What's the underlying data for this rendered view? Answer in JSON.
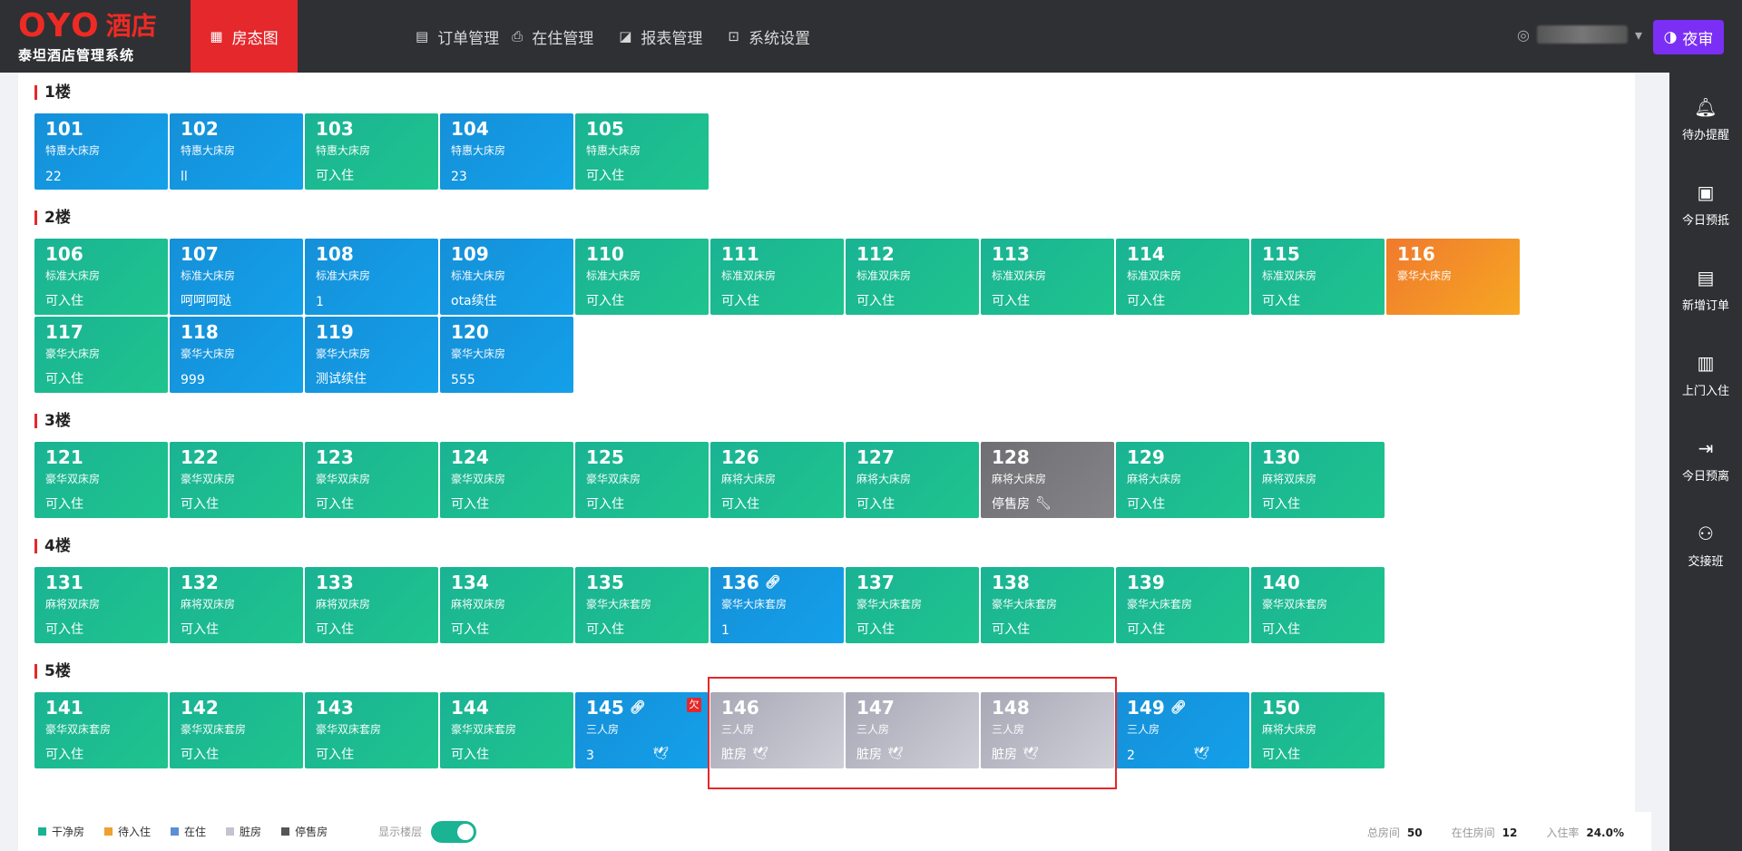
{
  "brand": {
    "logo_text": "OYO",
    "logo_hotel": "酒店",
    "system_name": "泰坦酒店管理系统"
  },
  "nav": [
    {
      "label": "房态图",
      "icon": "grid-icon",
      "active": true
    },
    {
      "label": "订单管理",
      "icon": "document-icon",
      "active": false
    },
    {
      "label": "在住管理",
      "icon": "printer-icon",
      "active": false
    },
    {
      "label": "报表管理",
      "icon": "chart-icon",
      "active": false
    },
    {
      "label": "系统设置",
      "icon": "monitor-icon",
      "active": false
    }
  ],
  "user": {
    "caret": "▾"
  },
  "night_audit": {
    "label": "夜审"
  },
  "sidebar": [
    {
      "label": "待办提醒",
      "icon": "bell-icon"
    },
    {
      "label": "今日预抵",
      "icon": "calendar-check-icon"
    },
    {
      "label": "新增订单",
      "icon": "new-order-icon"
    },
    {
      "label": "上门入住",
      "icon": "walk-in-icon"
    },
    {
      "label": "今日预离",
      "icon": "checkout-icon"
    },
    {
      "label": "交接班",
      "icon": "handover-icon"
    }
  ],
  "floors": [
    {
      "label": "1楼",
      "rooms": [
        {
          "num": "101",
          "type": "特惠大床房",
          "status": "22",
          "color": "blue"
        },
        {
          "num": "102",
          "type": "特惠大床房",
          "status": "ll",
          "color": "blue"
        },
        {
          "num": "103",
          "type": "特惠大床房",
          "status": "可入住",
          "color": "green"
        },
        {
          "num": "104",
          "type": "特惠大床房",
          "status": "23",
          "color": "blue"
        },
        {
          "num": "105",
          "type": "特惠大床房",
          "status": "可入住",
          "color": "green"
        }
      ]
    },
    {
      "label": "2楼",
      "rooms": [
        {
          "num": "106",
          "type": "标准大床房",
          "status": "可入住",
          "color": "green"
        },
        {
          "num": "107",
          "type": "标准大床房",
          "status": "呵呵呵哒",
          "color": "blue"
        },
        {
          "num": "108",
          "type": "标准大床房",
          "status": "1",
          "color": "blue"
        },
        {
          "num": "109",
          "type": "标准大床房",
          "status": "ota续住",
          "color": "blue"
        },
        {
          "num": "110",
          "type": "标准大床房",
          "status": "可入住",
          "color": "green"
        },
        {
          "num": "111",
          "type": "标准双床房",
          "status": "可入住",
          "color": "green"
        },
        {
          "num": "112",
          "type": "标准双床房",
          "status": "可入住",
          "color": "green"
        },
        {
          "num": "113",
          "type": "标准双床房",
          "status": "可入住",
          "color": "green"
        },
        {
          "num": "114",
          "type": "标准双床房",
          "status": "可入住",
          "color": "green"
        },
        {
          "num": "115",
          "type": "标准双床房",
          "status": "可入住",
          "color": "green"
        },
        {
          "num": "116",
          "type": "豪华大床房",
          "status": "",
          "color": "orange"
        },
        {
          "num": "117",
          "type": "豪华大床房",
          "status": "可入住",
          "color": "green"
        },
        {
          "num": "118",
          "type": "豪华大床房",
          "status": "999",
          "color": "blue"
        },
        {
          "num": "119",
          "type": "豪华大床房",
          "status": "测试续住",
          "color": "blue"
        },
        {
          "num": "120",
          "type": "豪华大床房",
          "status": "555",
          "color": "blue"
        }
      ]
    },
    {
      "label": "3楼",
      "rooms": [
        {
          "num": "121",
          "type": "豪华双床房",
          "status": "可入住",
          "color": "green"
        },
        {
          "num": "122",
          "type": "豪华双床房",
          "status": "可入住",
          "color": "green"
        },
        {
          "num": "123",
          "type": "豪华双床房",
          "status": "可入住",
          "color": "green"
        },
        {
          "num": "124",
          "type": "豪华双床房",
          "status": "可入住",
          "color": "green"
        },
        {
          "num": "125",
          "type": "豪华双床房",
          "status": "可入住",
          "color": "green"
        },
        {
          "num": "126",
          "type": "麻将大床房",
          "status": "可入住",
          "color": "green"
        },
        {
          "num": "127",
          "type": "麻将大床房",
          "status": "可入住",
          "color": "green"
        },
        {
          "num": "128",
          "type": "麻将大床房",
          "status": "停售房",
          "color": "grey",
          "icon": "wrench-icon"
        },
        {
          "num": "129",
          "type": "麻将大床房",
          "status": "可入住",
          "color": "green"
        },
        {
          "num": "130",
          "type": "麻将双床房",
          "status": "可入住",
          "color": "green"
        }
      ]
    },
    {
      "label": "4楼",
      "rooms": [
        {
          "num": "131",
          "type": "麻将双床房",
          "status": "可入住",
          "color": "green"
        },
        {
          "num": "132",
          "type": "麻将双床房",
          "status": "可入住",
          "color": "green"
        },
        {
          "num": "133",
          "type": "麻将双床房",
          "status": "可入住",
          "color": "green"
        },
        {
          "num": "134",
          "type": "麻将双床房",
          "status": "可入住",
          "color": "green"
        },
        {
          "num": "135",
          "type": "豪华大床套房",
          "status": "可入住",
          "color": "green"
        },
        {
          "num": "136",
          "type": "豪华大床套房",
          "status": "1",
          "color": "blue",
          "link": true
        },
        {
          "num": "137",
          "type": "豪华大床套房",
          "status": "可入住",
          "color": "green"
        },
        {
          "num": "138",
          "type": "豪华大床套房",
          "status": "可入住",
          "color": "green"
        },
        {
          "num": "139",
          "type": "豪华大床套房",
          "status": "可入住",
          "color": "green"
        },
        {
          "num": "140",
          "type": "豪华双床套房",
          "status": "可入住",
          "color": "green"
        }
      ]
    },
    {
      "label": "5楼",
      "rooms": [
        {
          "num": "141",
          "type": "豪华双床套房",
          "status": "可入住",
          "color": "green"
        },
        {
          "num": "142",
          "type": "豪华双床套房",
          "status": "可入住",
          "color": "green"
        },
        {
          "num": "143",
          "type": "豪华双床套房",
          "status": "可入住",
          "color": "green"
        },
        {
          "num": "144",
          "type": "豪华双床套房",
          "status": "可入住",
          "color": "green"
        },
        {
          "num": "145",
          "type": "三人房",
          "status": "3",
          "color": "blue",
          "link": true,
          "tag": "欠",
          "bird": true
        },
        {
          "num": "146",
          "type": "三人房",
          "status": "脏房",
          "color": "dirty",
          "bird_inline": true
        },
        {
          "num": "147",
          "type": "三人房",
          "status": "脏房",
          "color": "dirty",
          "bird_inline": true
        },
        {
          "num": "148",
          "type": "三人房",
          "status": "脏房",
          "color": "dirty",
          "bird_inline": true
        },
        {
          "num": "149",
          "type": "三人房",
          "status": "2",
          "color": "blue",
          "link": true,
          "bird": true
        },
        {
          "num": "150",
          "type": "麻将大床房",
          "status": "可入住",
          "color": "green"
        }
      ]
    }
  ],
  "legend": [
    {
      "label": "干净房",
      "color": "#1ab394"
    },
    {
      "label": "待入住",
      "color": "#f0a030"
    },
    {
      "label": "在住",
      "color": "#5b8ed6"
    },
    {
      "label": "脏房",
      "color": "#c4c4d0"
    },
    {
      "label": "停售房",
      "color": "#555555"
    }
  ],
  "toggle": {
    "label": "显示楼层",
    "on": true
  },
  "stats": [
    {
      "label": "总房间",
      "value": "50"
    },
    {
      "label": "在住房间",
      "value": "12"
    },
    {
      "label": "入住率",
      "value": "24.0%"
    }
  ]
}
